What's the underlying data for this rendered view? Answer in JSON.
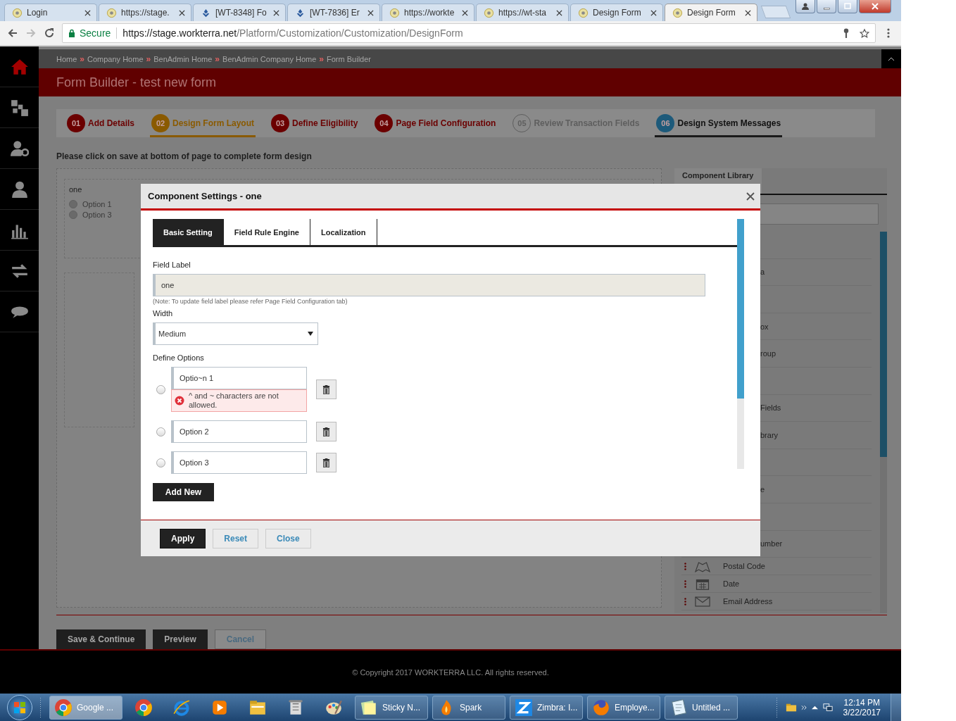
{
  "browser": {
    "tabs": [
      {
        "title": "Login",
        "kind": "site",
        "selected": false
      },
      {
        "title": "https://stage.",
        "kind": "site",
        "selected": false
      },
      {
        "title": "[WT-8348] Fo",
        "kind": "tracker",
        "selected": false
      },
      {
        "title": "[WT-7836] Er",
        "kind": "tracker",
        "selected": false
      },
      {
        "title": "https://workte",
        "kind": "site",
        "selected": false
      },
      {
        "title": "https://wt-sta",
        "kind": "site",
        "selected": false
      },
      {
        "title": "Design Form",
        "kind": "site",
        "selected": false
      },
      {
        "title": "Design Form",
        "kind": "site",
        "selected": true
      }
    ],
    "address": {
      "secure_label": "Secure",
      "host": "https://stage.workterra.net",
      "path": "/Platform/Customization/Customization/DesignForm"
    }
  },
  "sidebar": {
    "items": [
      {
        "kind": "home",
        "selected": true
      },
      {
        "kind": "puzzle",
        "selected": false
      },
      {
        "kind": "user-gear",
        "selected": false
      },
      {
        "kind": "user",
        "selected": false
      },
      {
        "kind": "chart",
        "selected": false
      },
      {
        "kind": "transfer",
        "selected": false
      },
      {
        "kind": "chat",
        "selected": false
      }
    ]
  },
  "breadcrumb": {
    "separator": "»",
    "items": [
      "Home",
      "Company Home",
      "BenAdmin Home",
      "BenAdmin Company Home",
      "Form Builder"
    ]
  },
  "page_title": "Form Builder - test new form",
  "steps": [
    {
      "number": "01",
      "label": "Add Details",
      "kind": "complete",
      "selected": false
    },
    {
      "number": "02",
      "label": "Design Form Layout",
      "kind": "current",
      "selected": true
    },
    {
      "number": "03",
      "label": "Define Eligibility",
      "kind": "complete",
      "selected": false
    },
    {
      "number": "04",
      "label": "Page Field Configuration",
      "kind": "complete",
      "selected": false
    },
    {
      "number": "05",
      "label": "Review Transaction Fields",
      "kind": "pending",
      "selected": false
    },
    {
      "number": "06",
      "label": "Design System Messages",
      "kind": "hover",
      "selected": false
    }
  ],
  "instruction": "Please click on save at bottom of page to complete form design",
  "canvas": {
    "field_label": "one",
    "options": [
      {
        "label": "Option 1",
        "selected": false
      },
      {
        "label": "Option 3",
        "selected": false
      }
    ]
  },
  "component_library": {
    "title": "Component Library",
    "items": [
      {
        "kind": "covered"
      },
      {
        "kind": "covered",
        "label": "a"
      },
      {
        "kind": "covered"
      },
      {
        "kind": "covered",
        "label": "ox"
      },
      {
        "kind": "covered",
        "label": "roup"
      },
      {
        "kind": "covered"
      },
      {
        "kind": "covered",
        "label": "Fields"
      },
      {
        "kind": "covered",
        "label": "brary"
      },
      {
        "kind": "covered"
      },
      {
        "kind": "covered",
        "label": "e"
      },
      {
        "kind": "covered"
      },
      {
        "kind": "covered",
        "label": "umber"
      },
      {
        "kind": "postal",
        "label": "Postal Code"
      },
      {
        "kind": "date",
        "label": "Date"
      },
      {
        "kind": "email",
        "label": "Email Address"
      }
    ]
  },
  "modal": {
    "title": "Component Settings - one",
    "tabs": [
      {
        "label": "Basic Setting",
        "selected": true
      },
      {
        "label": "Field Rule Engine",
        "selected": false
      },
      {
        "label": "Localization",
        "selected": false
      }
    ],
    "field_label": {
      "label": "Field Label",
      "value": "one",
      "note": "(Note: To update field label please refer Page Field Configuration tab)"
    },
    "width": {
      "label": "Width",
      "value": "Medium"
    },
    "options_label": "Define Options",
    "options": [
      {
        "value": "Optio~n 1",
        "selected": false,
        "error": "^ and ~ characters are not allowed."
      },
      {
        "value": "Option 2",
        "selected": false
      },
      {
        "value": "Option 3",
        "selected": false
      }
    ],
    "add_button": "Add New",
    "buttons": [
      {
        "label": "Apply",
        "kind": "primary"
      },
      {
        "label": "Reset",
        "kind": "secondary"
      },
      {
        "label": "Close",
        "kind": "secondary"
      }
    ]
  },
  "actions": [
    {
      "label": "Save & Continue",
      "disabled": false
    },
    {
      "label": "Preview",
      "disabled": false
    },
    {
      "label": "Cancel",
      "disabled": true
    }
  ],
  "footer": "© Copyright 2017 WORKTERRA LLC. All rights reserved.",
  "taskbar": {
    "items": [
      {
        "kind": "chrome",
        "label": "Google ...",
        "selected": true
      },
      {
        "kind": "chrome",
        "selected": false
      },
      {
        "kind": "ie",
        "selected": false
      },
      {
        "kind": "media",
        "selected": false
      },
      {
        "kind": "folder",
        "selected": false
      },
      {
        "kind": "scroll",
        "selected": false
      },
      {
        "kind": "paint",
        "selected": false
      },
      {
        "kind": "notes",
        "label": "Sticky N...",
        "selected": false
      },
      {
        "kind": "spark",
        "label": "Spark",
        "selected": false
      },
      {
        "kind": "zimbra",
        "label": "Zimbra: I...",
        "selected": false
      },
      {
        "kind": "firefox",
        "label": "Employe...",
        "selected": false
      },
      {
        "kind": "notepad",
        "label": "Untitled ...",
        "selected": false
      }
    ],
    "time": "12:14 PM",
    "date": "3/22/2017"
  }
}
